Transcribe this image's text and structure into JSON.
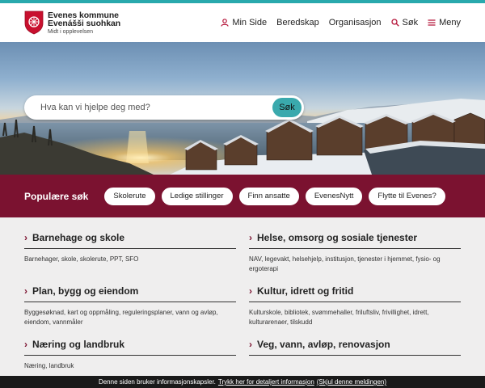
{
  "logo": {
    "line1": "Evenes kommune",
    "line2": "Evenášši suohkan",
    "line3": "Midt i opplevelsen"
  },
  "nav": {
    "items": [
      {
        "label": "Min Side",
        "icon": "person-icon"
      },
      {
        "label": "Beredskap"
      },
      {
        "label": "Organisasjon"
      },
      {
        "label": "Søk",
        "icon": "search-icon"
      },
      {
        "label": "Meny",
        "icon": "hamburger-icon"
      }
    ]
  },
  "search": {
    "placeholder": "Hva kan vi hjelpe deg med?",
    "button": "Søk"
  },
  "popular": {
    "title": "Populære søk",
    "chips": [
      "Skolerute",
      "Ledige stillinger",
      "Finn ansatte",
      "EvenesNytt",
      "Flytte til Evenes?"
    ]
  },
  "categories": [
    {
      "title": "Barnehage og skole",
      "desc": "Barnehager, skole, skolerute, PPT, SFO"
    },
    {
      "title": "Helse, omsorg og sosiale tjenester",
      "desc": "NAV, legevakt, helsehjelp, institusjon, tjenester i hjemmet, fysio- og ergoterapi"
    },
    {
      "title": "Plan, bygg og eiendom",
      "desc": "Byggesøknad, kart og oppmåling, reguleringsplaner, vann og avløp, eiendom, vannmåler"
    },
    {
      "title": "Kultur, idrett og fritid",
      "desc": "Kulturskole, bibliotek, svømmehaller, friluftsliv, frivillighet, idrett, kulturarenaer, tilskudd"
    },
    {
      "title": "Næring og landbruk",
      "desc": "Næring, landbruk"
    },
    {
      "title": "Veg, vann, avløp, renovasjon",
      "desc": ""
    }
  ],
  "cookie": {
    "text": "Denne siden bruker informasjonskapsler.",
    "link1": "Trykk her for detaljert informasjon",
    "link2": "(Skjul denne meldingen)"
  },
  "colors": {
    "accent": "#29a9ad",
    "brand": "#7b1230"
  }
}
